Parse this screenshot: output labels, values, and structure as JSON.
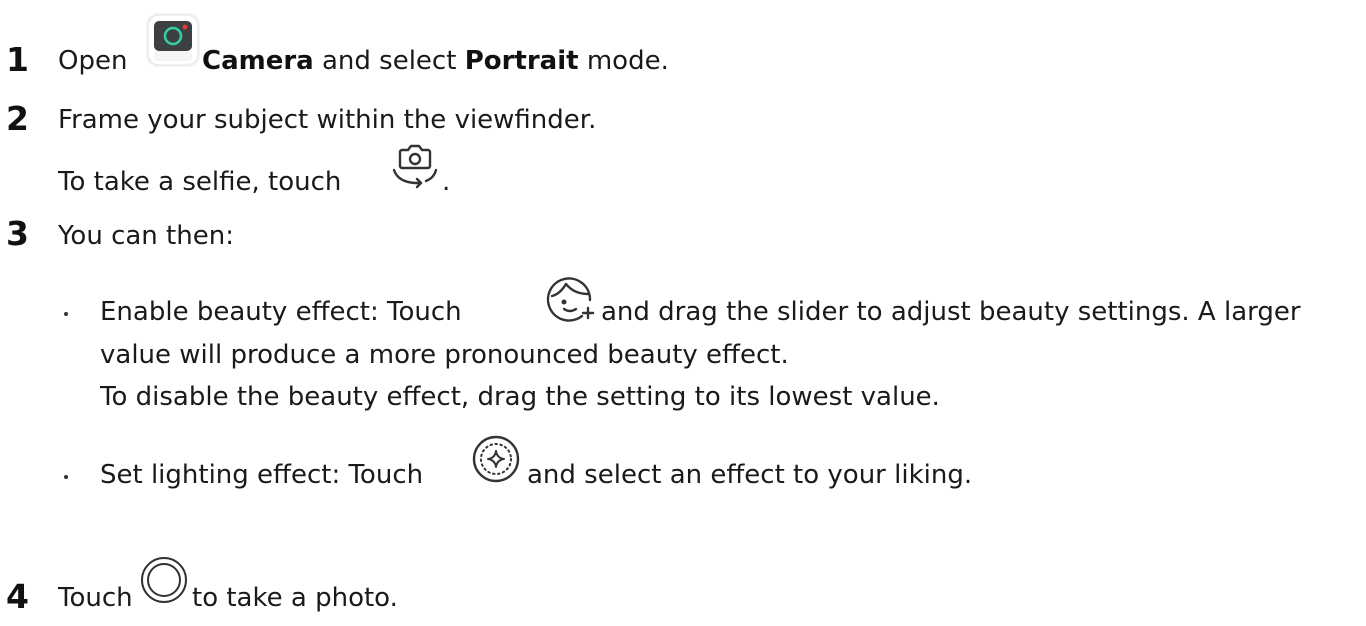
{
  "steps": [
    {
      "number": "1",
      "parts": {
        "a": "Open",
        "b": "Camera",
        "c": "and select",
        "d": "Portrait",
        "e": "mode."
      }
    },
    {
      "number": "2",
      "line1": "Frame your subject within the viewfinder.",
      "line2_prefix": "To take a selfie, touch",
      "line2_suffix": "."
    },
    {
      "number": "3",
      "intro": "You can then:",
      "bullets": [
        {
          "prefix": "Enable beauty effect: Touch",
          "suffix": "and drag the slider to adjust beauty settings. A larger",
          "line2": "value will produce a more pronounced beauty effect.",
          "line3": "To disable the beauty effect, drag the setting to its lowest value."
        },
        {
          "prefix": "Set lighting effect: Touch",
          "suffix": "and select an effect to your liking."
        }
      ]
    },
    {
      "number": "4",
      "prefix": "Touch",
      "suffix": "to take a photo."
    }
  ],
  "icons": {
    "camera_app": "camera-app-icon",
    "switch_camera": "switch-camera-icon",
    "beauty": "beauty-face-icon",
    "lighting": "lighting-effect-icon",
    "shutter": "shutter-icon"
  },
  "colors": {
    "camera_icon_bg": "#3c4043",
    "camera_icon_ring": "#34d0a0",
    "camera_icon_dot": "#e53935"
  }
}
